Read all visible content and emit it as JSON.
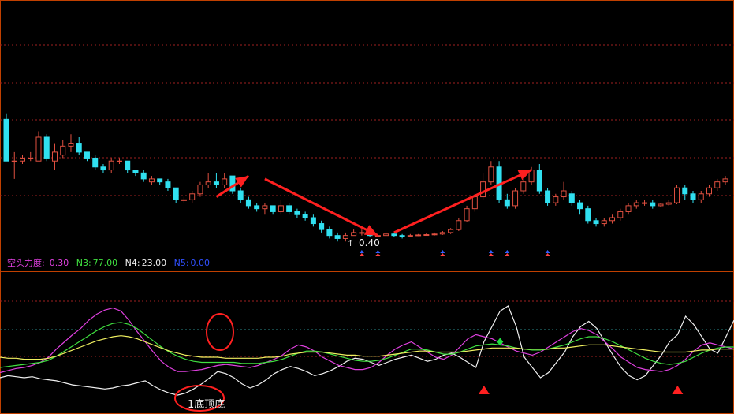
{
  "indicator": {
    "name": "空头力度:",
    "n2": "0.30",
    "n3_label": "N3:",
    "n3": "77.00",
    "n4_label": "N4:",
    "n4": "23.00",
    "n5_label": "N5:",
    "n5": "0.00"
  },
  "price_annotation": "0.40",
  "bottom_annotation": "1底顶底",
  "colors": {
    "frame": "#c04000",
    "up": "#e05040",
    "down": "#30e0f0",
    "arrow": "#ff2020",
    "purple": "#e040e0",
    "green": "#40e040",
    "yellow": "#f0f060",
    "white": "#f0f0f0",
    "blue": "#3050ff",
    "grid": "#a02020"
  },
  "chart_data": [
    {
      "type": "candlestick",
      "title": "",
      "candles": [
        [
          6.7,
          5.3,
          6.9,
          5.3
        ],
        [
          5.3,
          5.3,
          5.6,
          4.7
        ],
        [
          5.3,
          5.4,
          5.5,
          5.2
        ],
        [
          5.4,
          5.4,
          5.6,
          5.3
        ],
        [
          5.3,
          6.1,
          6.3,
          5.3
        ],
        [
          6.1,
          5.4,
          6.2,
          5.3
        ],
        [
          5.3,
          5.6,
          5.9,
          5.0
        ],
        [
          5.5,
          5.8,
          6.0,
          5.4
        ],
        [
          5.8,
          5.9,
          6.2,
          5.6
        ],
        [
          5.9,
          5.6,
          6.1,
          5.5
        ],
        [
          5.6,
          5.4,
          5.6,
          5.3
        ],
        [
          5.4,
          5.1,
          5.5,
          5.0
        ],
        [
          5.1,
          5.0,
          5.2,
          4.9
        ],
        [
          5.0,
          5.3,
          5.4,
          4.9
        ],
        [
          5.3,
          5.3,
          5.4,
          5.2
        ],
        [
          5.3,
          5.0,
          5.3,
          4.9
        ],
        [
          5.0,
          4.9,
          5.0,
          4.8
        ],
        [
          4.9,
          4.7,
          5.0,
          4.6
        ],
        [
          4.6,
          4.7,
          4.8,
          4.5
        ],
        [
          4.7,
          4.6,
          4.7,
          4.5
        ],
        [
          4.6,
          4.4,
          4.7,
          4.3
        ],
        [
          4.4,
          4.0,
          4.4,
          3.9
        ],
        [
          4.0,
          4.0,
          4.1,
          3.9
        ],
        [
          4.0,
          4.2,
          4.3,
          3.9
        ],
        [
          4.2,
          4.5,
          4.6,
          4.1
        ],
        [
          4.5,
          4.6,
          4.9,
          4.4
        ],
        [
          4.6,
          4.5,
          4.9,
          4.4
        ],
        [
          4.5,
          4.7,
          4.9,
          4.4
        ],
        [
          4.8,
          4.3,
          4.8,
          4.2
        ],
        [
          4.3,
          4.0,
          4.4,
          3.9
        ],
        [
          4.0,
          3.8,
          4.1,
          3.7
        ],
        [
          3.8,
          3.7,
          3.9,
          3.6
        ],
        [
          3.7,
          3.8,
          3.9,
          3.5
        ],
        [
          3.8,
          3.6,
          3.8,
          3.5
        ],
        [
          3.6,
          3.8,
          4.0,
          3.5
        ],
        [
          3.8,
          3.6,
          3.9,
          3.5
        ],
        [
          3.6,
          3.5,
          3.7,
          3.4
        ],
        [
          3.5,
          3.4,
          3.6,
          3.3
        ],
        [
          3.4,
          3.2,
          3.5,
          3.1
        ],
        [
          3.2,
          3.0,
          3.3,
          2.9
        ],
        [
          3.0,
          2.8,
          3.1,
          2.7
        ],
        [
          2.8,
          2.7,
          2.9,
          2.6
        ],
        [
          2.7,
          2.8,
          2.9,
          2.6
        ],
        [
          2.8,
          2.9,
          3.0,
          2.8
        ],
        [
          2.9,
          2.9,
          3.0,
          2.8
        ],
        [
          2.9,
          2.8,
          2.9,
          2.75
        ],
        [
          2.8,
          2.8,
          2.9,
          2.75
        ],
        [
          2.8,
          2.85,
          2.9,
          2.8
        ],
        [
          2.85,
          2.8,
          2.9,
          2.75
        ],
        [
          2.8,
          2.78,
          2.85,
          2.7
        ],
        [
          2.78,
          2.8,
          2.85,
          2.75
        ],
        [
          2.8,
          2.82,
          2.85,
          2.78
        ],
        [
          2.82,
          2.83,
          2.87,
          2.8
        ],
        [
          2.83,
          2.85,
          2.9,
          2.8
        ],
        [
          2.85,
          2.9,
          2.95,
          2.82
        ],
        [
          2.9,
          3.0,
          3.05,
          2.85
        ],
        [
          3.0,
          3.3,
          3.4,
          2.95
        ],
        [
          3.3,
          3.7,
          3.8,
          3.25
        ],
        [
          3.7,
          4.1,
          4.2,
          3.6
        ],
        [
          4.1,
          4.6,
          4.9,
          4.0
        ],
        [
          4.6,
          5.1,
          5.3,
          4.5
        ],
        [
          5.1,
          4.0,
          5.3,
          3.9
        ],
        [
          4.0,
          3.8,
          4.2,
          3.7
        ],
        [
          3.8,
          4.3,
          4.4,
          3.7
        ],
        [
          4.3,
          4.6,
          4.8,
          4.2
        ],
        [
          4.6,
          5.0,
          5.1,
          4.5
        ],
        [
          5.0,
          4.3,
          5.2,
          4.2
        ],
        [
          4.3,
          3.9,
          4.4,
          3.8
        ],
        [
          3.9,
          4.1,
          4.2,
          3.8
        ],
        [
          4.1,
          4.3,
          4.6,
          4.0
        ],
        [
          4.2,
          3.9,
          4.3,
          3.8
        ],
        [
          3.9,
          3.7,
          4.0,
          3.5
        ],
        [
          3.7,
          3.3,
          3.8,
          3.2
        ],
        [
          3.3,
          3.2,
          3.4,
          3.1
        ],
        [
          3.2,
          3.3,
          3.4,
          3.1
        ],
        [
          3.3,
          3.4,
          3.5,
          3.2
        ],
        [
          3.4,
          3.6,
          3.7,
          3.3
        ],
        [
          3.6,
          3.8,
          3.9,
          3.5
        ],
        [
          3.8,
          3.9,
          4.0,
          3.7
        ],
        [
          3.9,
          3.9,
          4.0,
          3.8
        ],
        [
          3.9,
          3.8,
          4.0,
          3.7
        ],
        [
          3.8,
          3.85,
          3.9,
          3.75
        ],
        [
          3.85,
          3.9,
          4.0,
          3.8
        ],
        [
          3.9,
          4.4,
          4.5,
          3.85
        ],
        [
          4.4,
          4.2,
          4.5,
          4.0
        ],
        [
          4.2,
          4.0,
          4.3,
          3.9
        ],
        [
          4.0,
          4.2,
          4.3,
          3.9
        ],
        [
          4.2,
          4.4,
          4.5,
          4.1
        ],
        [
          4.4,
          4.6,
          4.7,
          4.3
        ],
        [
          4.6,
          4.7,
          4.8,
          4.5
        ]
      ],
      "signal_markers": [
        44,
        46,
        54,
        60,
        62,
        67
      ],
      "trend_arrows": [
        [
          26,
          4.1,
          30,
          4.8
        ],
        [
          32,
          4.7,
          46,
          2.8
        ],
        [
          48,
          2.9,
          65,
          5.0
        ]
      ]
    },
    {
      "type": "line",
      "series": [
        {
          "color": "#f0f0f0",
          "values": [
            20,
            22,
            21,
            20,
            21,
            19,
            18,
            17,
            15,
            13,
            12,
            11,
            10,
            9,
            10,
            12,
            13,
            15,
            17,
            12,
            8,
            5,
            3,
            5,
            9,
            14,
            20,
            26,
            24,
            20,
            14,
            10,
            13,
            18,
            24,
            28,
            31,
            29,
            26,
            22,
            24,
            27,
            31,
            36,
            39,
            38,
            35,
            32,
            35,
            38,
            40,
            42,
            39,
            36,
            38,
            42,
            44,
            40,
            35,
            30,
            55,
            70,
            85,
            90,
            70,
            40,
            30,
            20,
            25,
            35,
            45,
            60,
            70,
            75,
            68,
            55,
            42,
            30,
            22,
            18,
            22,
            32,
            42,
            55,
            62,
            80,
            72,
            60,
            48,
            44,
            60,
            76
          ]
        },
        {
          "color": "#e040e0",
          "values": [
            25,
            27,
            29,
            30,
            32,
            35,
            40,
            48,
            55,
            62,
            68,
            76,
            82,
            86,
            88,
            85,
            76,
            65,
            55,
            45,
            36,
            30,
            26,
            26,
            27,
            28,
            30,
            32,
            33,
            32,
            31,
            30,
            32,
            35,
            38,
            42,
            48,
            52,
            50,
            46,
            40,
            36,
            32,
            30,
            28,
            28,
            30,
            35,
            42,
            48,
            52,
            55,
            50,
            45,
            40,
            38,
            42,
            50,
            58,
            62,
            60,
            58,
            54,
            50,
            46,
            44,
            42,
            45,
            50,
            55,
            60,
            65,
            68,
            66,
            62,
            55,
            48,
            40,
            35,
            30,
            28,
            27,
            26,
            28,
            32,
            38,
            46,
            52,
            54,
            52,
            50,
            48
          ]
        },
        {
          "color": "#40e040",
          "values": [
            30,
            31,
            32,
            33,
            34,
            35,
            37,
            41,
            46,
            51,
            56,
            61,
            66,
            70,
            73,
            74,
            72,
            68,
            62,
            56,
            50,
            45,
            41,
            38,
            36,
            35,
            35,
            35,
            35,
            35,
            34,
            34,
            34,
            35,
            36,
            38,
            41,
            44,
            46,
            46,
            45,
            43,
            41,
            39,
            37,
            36,
            36,
            37,
            39,
            42,
            45,
            48,
            48,
            47,
            45,
            43,
            43,
            45,
            48,
            51,
            52,
            53,
            52,
            51,
            49,
            48,
            47,
            47,
            48,
            50,
            52,
            55,
            58,
            60,
            60,
            58,
            55,
            51,
            47,
            43,
            39,
            36,
            34,
            33,
            34,
            36,
            40,
            44,
            47,
            49,
            50,
            50
          ]
        },
        {
          "color": "#f0f060",
          "values": [
            40,
            39,
            39,
            38,
            38,
            38,
            39,
            41,
            44,
            47,
            50,
            53,
            56,
            58,
            60,
            61,
            60,
            58,
            55,
            52,
            49,
            46,
            44,
            42,
            41,
            40,
            40,
            40,
            39,
            39,
            39,
            39,
            39,
            40,
            40,
            41,
            43,
            44,
            45,
            45,
            45,
            44,
            43,
            42,
            42,
            41,
            41,
            41,
            42,
            43,
            44,
            45,
            46,
            46,
            45,
            45,
            45,
            45,
            46,
            47,
            48,
            49,
            49,
            49,
            49,
            48,
            48,
            48,
            48,
            49,
            49,
            50,
            51,
            52,
            52,
            52,
            51,
            50,
            49,
            48,
            47,
            46,
            45,
            45,
            45,
            45,
            46,
            47,
            47,
            48,
            48,
            48
          ]
        }
      ],
      "buy_markers": [
        60,
        84
      ],
      "sell_markers": [
        62
      ]
    }
  ]
}
